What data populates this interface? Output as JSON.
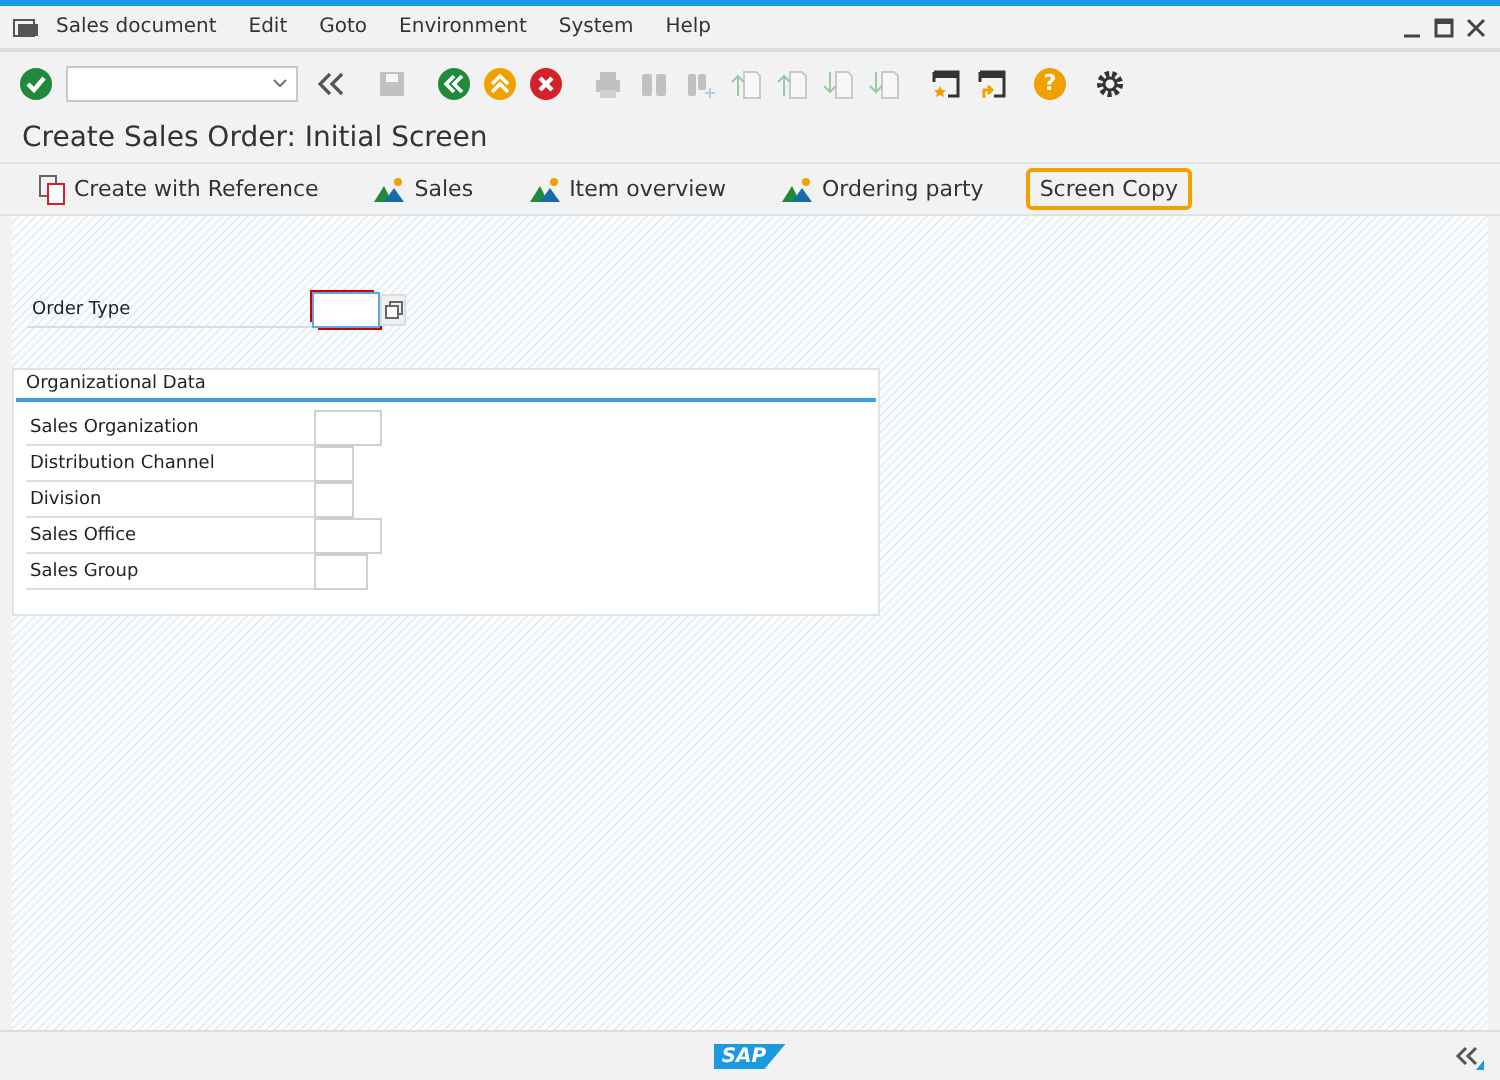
{
  "menu_bar": [
    "Sales document",
    "Edit",
    "Goto",
    "Environment",
    "System",
    "Help"
  ],
  "toolbar": [
    {
      "kind": "enter",
      "disabled": false
    },
    {
      "kind": "command",
      "disabled": false
    },
    {
      "kind": "collapse",
      "disabled": false
    },
    {
      "kind": "save",
      "disabled": true
    },
    {
      "kind": "back",
      "disabled": false
    },
    {
      "kind": "exit",
      "disabled": false
    },
    {
      "kind": "cancel",
      "disabled": false
    },
    {
      "kind": "print",
      "disabled": true
    },
    {
      "kind": "find",
      "disabled": true
    },
    {
      "kind": "find_next",
      "disabled": true
    },
    {
      "kind": "first_page",
      "disabled": true
    },
    {
      "kind": "previous_page",
      "disabled": true
    },
    {
      "kind": "next_page",
      "disabled": true
    },
    {
      "kind": "last_page",
      "disabled": true
    },
    {
      "kind": "new_session",
      "disabled": false
    },
    {
      "kind": "shortcut",
      "disabled": false
    },
    {
      "kind": "help",
      "disabled": false,
      "symbol": "?"
    },
    {
      "kind": "settings",
      "disabled": false
    }
  ],
  "title": "Create Sales Order: Initial Screen",
  "app_toolbar": [
    {
      "kind": "reference",
      "label": "Create with Reference",
      "highlighted": false
    },
    {
      "kind": "mountain",
      "label": "Sales",
      "highlighted": false
    },
    {
      "kind": "mountain",
      "label": "Item overview",
      "highlighted": false
    },
    {
      "kind": "mountain",
      "label": "Ordering party",
      "highlighted": false
    },
    {
      "kind": "plain",
      "label": "Screen Copy",
      "highlighted": true
    }
  ],
  "order_type": {
    "label": "Order Type",
    "focused": true
  },
  "org_data": {
    "title": "Organizational Data",
    "fields": [
      {
        "label": "Sales Organization"
      },
      {
        "label": "Distribution Channel"
      },
      {
        "label": "Division"
      },
      {
        "label": "Sales Office"
      },
      {
        "label": "Sales Group"
      }
    ]
  },
  "footer": {
    "logo": "SAP"
  }
}
